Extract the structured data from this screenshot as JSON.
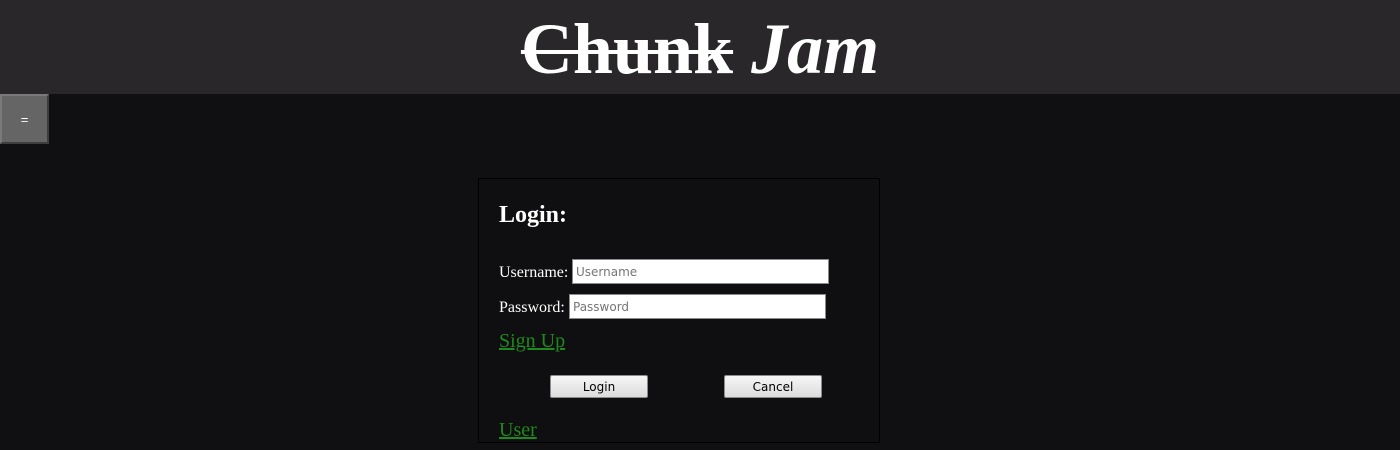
{
  "header": {
    "title_struck": "Chunk",
    "title_italic": "Jam"
  },
  "menu_button": {
    "label": "="
  },
  "login": {
    "heading": "Login:",
    "username_label": "Username:",
    "username_placeholder": "Username",
    "password_label": "Password:",
    "password_placeholder": "Password",
    "signup_link": "Sign Up",
    "login_button": "Login",
    "cancel_button": "Cancel",
    "user_link": "User"
  },
  "colors": {
    "header_bg": "#29272a",
    "page_bg": "#100f12",
    "link": "#1e8a1a"
  }
}
